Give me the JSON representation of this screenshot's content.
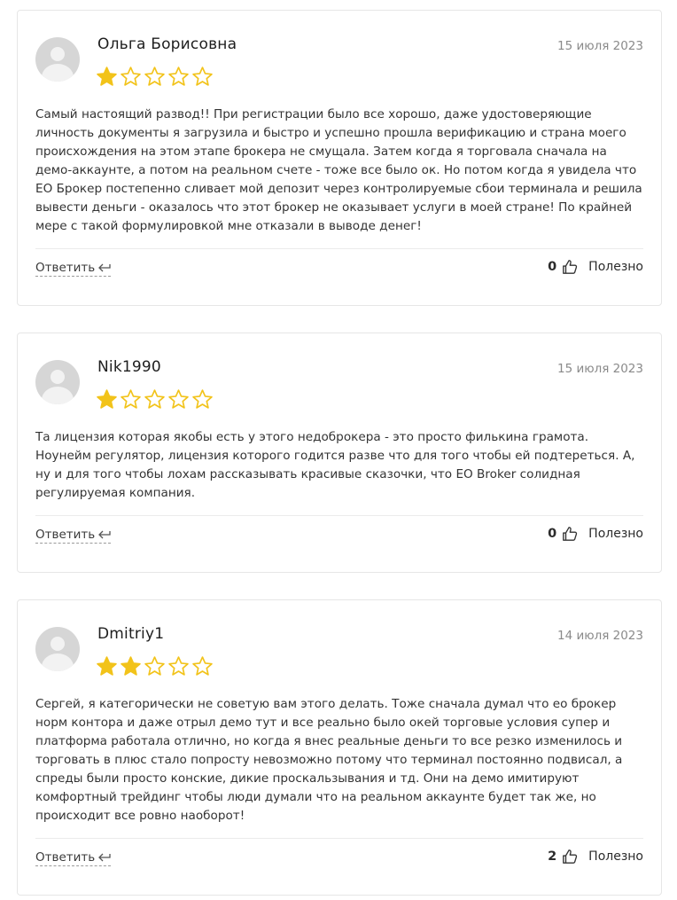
{
  "colors": {
    "star_filled": "#f2c31a",
    "star_empty_stroke": "#f2c31a",
    "border": "#e6e6e6"
  },
  "reviews": [
    {
      "author": "Ольга Борисовна",
      "date": "15 июля 2023",
      "rating": 1,
      "text": "Самый настоящий развод!! При регистрации было все хорошо, даже удостоверяющие личность документы я загрузила и быстро и успешно прошла верификацию и страна моего происхождения на этом этапе брокера не смущала. Затем когда я торговала сначала на демо-аккаунте, а потом на реальном счете - тоже все было ок. Но потом когда я увидела что ЕО Брокер постепенно сливает мой депозит через контролируемые сбои терминала и решила вывести деньги - оказалось что этот брокер не оказывает услуги в моей стране! По крайней мере с такой формулировкой мне отказали в выводе денег!",
      "reply_label": "Ответить",
      "votes": "0",
      "useful_label": "Полезно"
    },
    {
      "author": "Nik1990",
      "date": "15 июля 2023",
      "rating": 1,
      "text": "Та лицензия которая якобы есть у этого недоброкера - это просто филькина грамота. Ноунейм регулятор, лицензия которого годится разве что для того чтобы ей подтереться. А, ну и для того чтобы лохам рассказывать красивые сказочки, что ЕО Broker солидная регулируемая компания.",
      "reply_label": "Ответить",
      "votes": "0",
      "useful_label": "Полезно"
    },
    {
      "author": "Dmitriy1",
      "date": "14 июля 2023",
      "rating": 2,
      "text": "Сергей, я категорически не советую вам этого делать. Тоже сначала думал что ео брокер норм контора и даже отрыл демо тут и все реально было окей торговые условия супер и платформа работала отлично, но когда я внес реальные деньги то все резко изменилось и торговать в плюс стало попросту невозможно потому что терминал постоянно подвисал, а спреды были просто конские, дикие проскальзывания и тд. Они на демо имитируют комфортный трейдинг чтобы люди думали что на реальном аккаунте будет так же, но происходит все ровно наоборот!",
      "reply_label": "Ответить",
      "votes": "2",
      "useful_label": "Полезно"
    }
  ]
}
